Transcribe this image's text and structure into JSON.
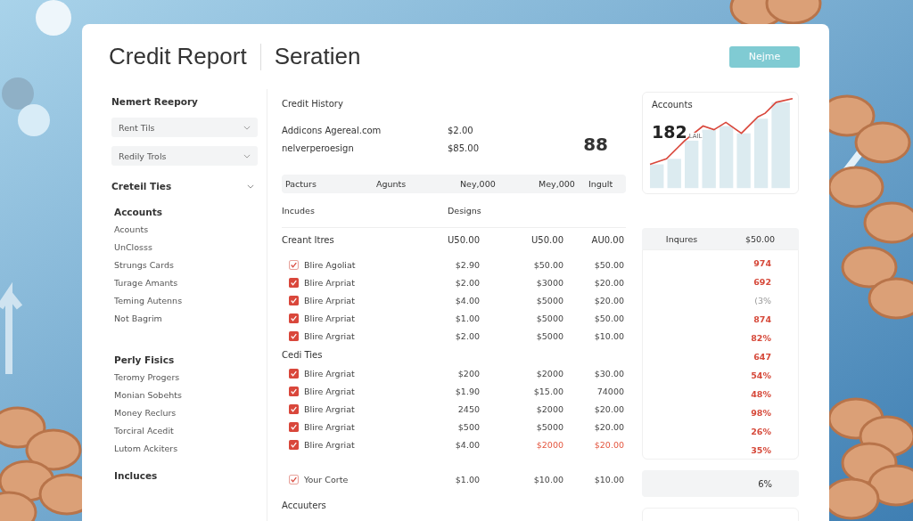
{
  "header": {
    "title": "Credit Report",
    "subtitle": "Seratien",
    "button": "Nejme"
  },
  "sidebar": {
    "heading": "Nemert Reepory",
    "dropdowns": [
      "Rent Tils",
      "Redily Trols"
    ],
    "section": {
      "label": "Creteil Ties",
      "expanded": true
    },
    "groups": [
      {
        "title": "Accounts",
        "items": [
          "Acounts",
          "UnClosss",
          "Strungs Cards",
          "Turage Amants",
          "Teming Autenns",
          "Not Bagrim"
        ]
      },
      {
        "title": "Perly Fisics",
        "items": [
          "Teromy Progers",
          "Monian Sobehts",
          "Money Reclurs",
          "Torciral Acedit",
          "Lutom Ackiters"
        ]
      }
    ],
    "footer_heading": "Incluces"
  },
  "history": {
    "title": "Credit History",
    "rows": [
      {
        "name": "Addicons Agereal.com",
        "amount": "$2.00"
      },
      {
        "name": "nelverperoesign",
        "amount": "$85.00"
      }
    ],
    "score": "88"
  },
  "table": {
    "columns": [
      "Pacturs",
      "Agunts",
      "Ney,000",
      "Mey,000",
      "Ingult"
    ],
    "subheader": [
      "Incudes",
      "Designs"
    ],
    "sections": [
      {
        "title": "Creant Itres",
        "totals": [
          "U50.00",
          "U50.00",
          "AU0.00"
        ],
        "rows": [
          {
            "label": "Blire Agoliat",
            "checked": false,
            "flagged": false,
            "values": [
              "$2.90",
              "$50.00",
              "$50.00"
            ]
          },
          {
            "label": "Blire Arpriat",
            "checked": true,
            "flagged": false,
            "values": [
              "$2.00",
              "$3000",
              "$20.00"
            ]
          },
          {
            "label": "Blire Arpriat",
            "checked": true,
            "flagged": false,
            "values": [
              "$4.00",
              "$5000",
              "$20.00"
            ]
          },
          {
            "label": "Blire Arpriat",
            "checked": true,
            "flagged": false,
            "values": [
              "$1.00",
              "$5000",
              "$50.00"
            ]
          },
          {
            "label": "Blire Argriat",
            "checked": true,
            "flagged": false,
            "values": [
              "$2.00",
              "$5000",
              "$10.00"
            ]
          }
        ]
      },
      {
        "title": "Cedi Ties",
        "rows": [
          {
            "label": "Blire Argriat",
            "checked": true,
            "flagged": false,
            "values": [
              "$200",
              "$2000",
              "$30.00"
            ]
          },
          {
            "label": "Blire Argriat",
            "checked": true,
            "flagged": false,
            "values": [
              "$1.90",
              "$15.00",
              "74000"
            ]
          },
          {
            "label": "Blire Argriat",
            "checked": true,
            "flagged": false,
            "values": [
              "2450",
              "$2000",
              "$20.00"
            ]
          },
          {
            "label": "Blire Argriat",
            "checked": true,
            "flagged": false,
            "values": [
              "$500",
              "$5000",
              "$20.00"
            ]
          },
          {
            "label": "Blire Argriat",
            "checked": true,
            "flagged": true,
            "values": [
              "$4.00",
              "$2000",
              "$20.00"
            ]
          }
        ]
      }
    ],
    "footer_row": {
      "label": "Your Corte",
      "checked": false,
      "flagged": false,
      "values": [
        "$1.00",
        "$10.00",
        "$10.00"
      ]
    },
    "trailing": "Accuuters"
  },
  "accounts_card": {
    "title": "Accounts",
    "value": "182",
    "unit": "LAIL"
  },
  "inquiries": {
    "label": "Inqures",
    "amount": "$50.00",
    "values": [
      {
        "text": "974",
        "muted": false
      },
      {
        "text": "692",
        "muted": false
      },
      {
        "text": "(3%",
        "muted": true
      },
      {
        "text": "874",
        "muted": false
      },
      {
        "text": "82%",
        "muted": false
      },
      {
        "text": "647",
        "muted": false
      },
      {
        "text": "54%",
        "muted": false
      },
      {
        "text": "48%",
        "muted": false
      },
      {
        "text": "98%",
        "muted": false
      },
      {
        "text": "26%",
        "muted": false
      },
      {
        "text": "35%",
        "muted": false
      }
    ]
  },
  "summary": "6%"
}
